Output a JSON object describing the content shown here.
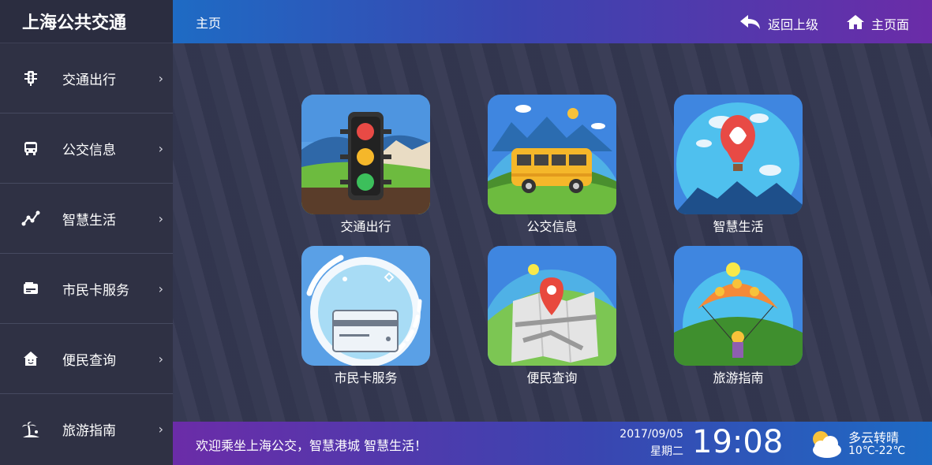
{
  "app": {
    "title": "上海公共交通"
  },
  "sidebar": {
    "items": [
      {
        "label": "交通出行",
        "icon": "traffic-light-icon"
      },
      {
        "label": "公交信息",
        "icon": "bus-icon"
      },
      {
        "label": "智慧生活",
        "icon": "network-nodes-icon"
      },
      {
        "label": "市民卡服务",
        "icon": "card-icon"
      },
      {
        "label": "便民查询",
        "icon": "house-smile-icon"
      },
      {
        "label": "旅游指南",
        "icon": "palm-tree-icon"
      }
    ],
    "chevron": "›"
  },
  "header": {
    "breadcrumb": "主页",
    "back_label": "返回上级",
    "home_label": "主页面"
  },
  "tiles": [
    {
      "label": "交通出行",
      "icon": "traffic-light-illustration"
    },
    {
      "label": "公交信息",
      "icon": "bus-illustration"
    },
    {
      "label": "智慧生活",
      "icon": "hot-air-balloon-illustration"
    },
    {
      "label": "市民卡服务",
      "icon": "card-illustration"
    },
    {
      "label": "便民查询",
      "icon": "map-pin-illustration"
    },
    {
      "label": "旅游指南",
      "icon": "paraglider-illustration"
    }
  ],
  "footer": {
    "welcome": "欢迎乘坐上海公交，智慧港城 智慧生活！",
    "date": "2017/09/05",
    "weekday": "星期二",
    "time": "19:08",
    "weather": "多云转晴",
    "temperature": "10℃-22℃",
    "weather_icon": "partly-cloudy-icon"
  },
  "colors": {
    "sidebar_bg": "#2f3144",
    "header_gradient_start": "#1e6bc4",
    "header_gradient_end": "#6b2ca8"
  }
}
